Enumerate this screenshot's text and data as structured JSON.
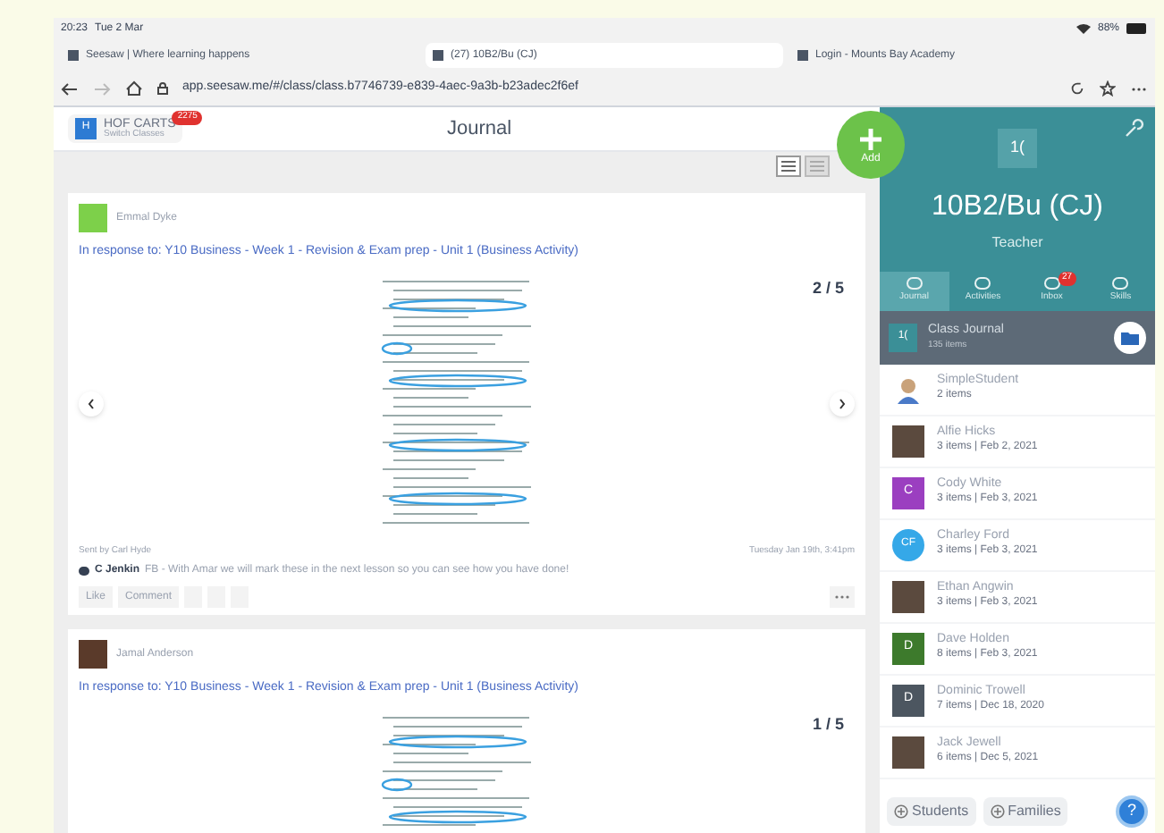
{
  "status_bar": {
    "time": "20:23",
    "date": "Tue 2 Mar",
    "battery": "88%"
  },
  "browser": {
    "tabs": [
      {
        "title": "Seesaw | Where learning happens",
        "selected": false
      },
      {
        "title": "(27) 10B2/Bu (CJ)",
        "selected": true
      },
      {
        "title": "Login - Mounts Bay Academy",
        "selected": false
      }
    ],
    "url": "app.seesaw.me/#/class/class.b7746739-e839-4aec-9a3b-b23adec2f6ef"
  },
  "header": {
    "class_initial": "H",
    "class_name": "HOF CARTS",
    "class_sub": "Switch Classes",
    "badge": "2275",
    "title": "Journal"
  },
  "add_button": {
    "label": "Add"
  },
  "posts": [
    {
      "author": "Emmal Dyke",
      "title": "In response to: Y10 Business - Week 1 - Revision & Exam prep - Unit 1 (Business Activity)",
      "page": "2 / 5",
      "added_by": "Sent by Carl Hyde",
      "time": "Tuesday Jan 19th, 3:41pm",
      "comment_author": "C Jenkin",
      "comment": "FB - With Amar we will mark these in the next lesson so you can see how you have done!",
      "actions": [
        "Like",
        "Comment"
      ]
    },
    {
      "author": "Jamal Anderson",
      "title": "In response to: Y10 Business - Week 1 - Revision & Exam prep - Unit 1 (Business Activity)",
      "page": "1 / 5"
    }
  ],
  "sidebar": {
    "class_icon": "1(",
    "class_name": "10B2/Bu (CJ)",
    "role": "Teacher",
    "nav": [
      {
        "label": "Journal",
        "selected": true
      },
      {
        "label": "Activities",
        "selected": false
      },
      {
        "label": "Inbox",
        "selected": false,
        "badge": "27"
      },
      {
        "label": "Skills",
        "selected": false
      }
    ],
    "class_journal": {
      "icon": "1(",
      "title": "Class Journal",
      "count": "135 items"
    },
    "students": [
      {
        "name": "SimpleStudent",
        "meta": "2 items",
        "kind": "cartoon"
      },
      {
        "name": "Alfie Hicks",
        "meta": "3 items | Feb 2, 2021",
        "kind": "photo"
      },
      {
        "name": "Cody White",
        "meta": "3 items | Feb 3, 2021",
        "kind": "letter",
        "initial": "C",
        "color": "#9b3fc0"
      },
      {
        "name": "Charley Ford",
        "meta": "3 items | Feb 3, 2021",
        "kind": "circle",
        "initial": "CF",
        "color": "#35a8e8"
      },
      {
        "name": "Ethan Angwin",
        "meta": "3 items | Feb 3, 2021",
        "kind": "photo"
      },
      {
        "name": "Dave Holden",
        "meta": "8 items | Feb 3, 2021",
        "kind": "letter",
        "initial": "D",
        "color": "#3d7a2c"
      },
      {
        "name": "Dominic Trowell",
        "meta": "7 items | Dec 18, 2020",
        "kind": "letter",
        "initial": "D",
        "color": "#4c5660"
      },
      {
        "name": "Jack Jewell",
        "meta": "6 items | Dec 5, 2021",
        "kind": "photo"
      }
    ],
    "buttons": [
      "Students",
      "Families"
    ],
    "help": "?"
  }
}
